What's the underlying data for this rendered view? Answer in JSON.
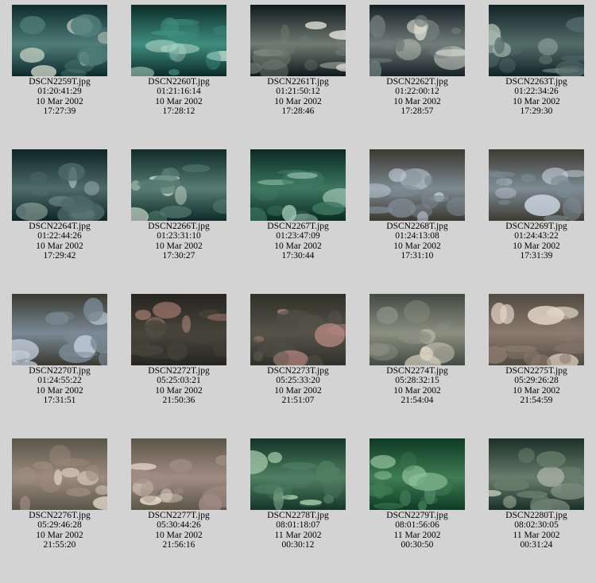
{
  "thumbnails": [
    {
      "file": "DSCN2259T.jpg",
      "timecode": "01:20:41:29",
      "date": "10 Mar 2002",
      "time": "17:27:39",
      "colors": [
        "#0d2a2d",
        "#4f7d79",
        "#c9d2c4"
      ]
    },
    {
      "file": "DSCN2260T.jpg",
      "timecode": "01:21:16:14",
      "date": "10 Mar 2002",
      "time": "17:28:12",
      "colors": [
        "#0b2b28",
        "#3f8d7f",
        "#b9dccb"
      ]
    },
    {
      "file": "DSCN2261T.jpg",
      "timecode": "01:21:50:12",
      "date": "10 Mar 2002",
      "time": "17:28:46",
      "colors": [
        "#10191b",
        "#6f7a73",
        "#e2e0d6"
      ]
    },
    {
      "file": "DSCN2262T.jpg",
      "timecode": "01:22:00:12",
      "date": "10 Mar 2002",
      "time": "17:28:57",
      "colors": [
        "#142024",
        "#707d79",
        "#dcdcd2"
      ]
    },
    {
      "file": "DSCN2263T.jpg",
      "timecode": "01:22:34:26",
      "date": "10 Mar 2002",
      "time": "17:29:30",
      "colors": [
        "#102326",
        "#556d69",
        "#aebfb6"
      ]
    },
    {
      "file": "DSCN2264T.jpg",
      "timecode": "01:22:44:26",
      "date": "10 Mar 2002",
      "time": "17:29:42",
      "colors": [
        "#0e2326",
        "#4d6b68",
        "#a8bdb5"
      ]
    },
    {
      "file": "DSCN2266T.jpg",
      "timecode": "01:23:31:10",
      "date": "10 Mar 2002",
      "time": "17:30:27",
      "colors": [
        "#0f2a27",
        "#577d73",
        "#c8d5c8"
      ]
    },
    {
      "file": "DSCN2267T.jpg",
      "timecode": "01:23:47:09",
      "date": "10 Mar 2002",
      "time": "17:30:44",
      "colors": [
        "#0b2a22",
        "#3d7762",
        "#a3cab7"
      ]
    },
    {
      "file": "DSCN2268T.jpg",
      "timecode": "01:24:13:08",
      "date": "10 Mar 2002",
      "time": "17:31:10",
      "colors": [
        "#3b3830",
        "#7d8a92",
        "#c8d3e0"
      ]
    },
    {
      "file": "DSCN2269T.jpg",
      "timecode": "01:24:43:22",
      "date": "10 Mar 2002",
      "time": "17:31:39",
      "colors": [
        "#3d3a31",
        "#7d8b93",
        "#cbd6e2"
      ]
    },
    {
      "file": "DSCN2270T.jpg",
      "timecode": "01:24:55:22",
      "date": "10 Mar 2002",
      "time": "17:31:51",
      "colors": [
        "#3a3931",
        "#7a8994",
        "#c9d4e1"
      ]
    },
    {
      "file": "DSCN2272T.jpg",
      "timecode": "05:25:03:21",
      "date": "10 Mar 2002",
      "time": "21:50:36",
      "colors": [
        "#262520",
        "#47453b",
        "#b28377"
      ]
    },
    {
      "file": "DSCN2273T.jpg",
      "timecode": "05:25:33:20",
      "date": "10 Mar 2002",
      "time": "21:51:07",
      "colors": [
        "#30302a",
        "#555349",
        "#b88a80"
      ]
    },
    {
      "file": "DSCN2274T.jpg",
      "timecode": "05:28:32:15",
      "date": "10 Mar 2002",
      "time": "21:54:04",
      "colors": [
        "#434a44",
        "#8c8f80",
        "#d6cfc0"
      ]
    },
    {
      "file": "DSCN2275T.jpg",
      "timecode": "05:29:26:28",
      "date": "10 Mar 2002",
      "time": "21:54:59",
      "colors": [
        "#4f4b41",
        "#8b7a6f",
        "#e3d6c8"
      ]
    },
    {
      "file": "DSCN2276T.jpg",
      "timecode": "05:29:46:28",
      "date": "10 Mar 2002",
      "time": "21:55:20",
      "colors": [
        "#5a5649",
        "#9d8a80",
        "#e8dccf"
      ]
    },
    {
      "file": "DSCN2277T.jpg",
      "timecode": "05:30:44:26",
      "date": "10 Mar 2002",
      "time": "21:56:16",
      "colors": [
        "#5c5649",
        "#a08c84",
        "#eee2d4"
      ]
    },
    {
      "file": "DSCN2278T.jpg",
      "timecode": "08:01:18:07",
      "date": "11 Mar 2002",
      "time": "00:30:12",
      "colors": [
        "#123527",
        "#4f7f62",
        "#a7c9aa"
      ]
    },
    {
      "file": "DSCN2279T.jpg",
      "timecode": "08:01:56:06",
      "date": "11 Mar 2002",
      "time": "00:30:50",
      "colors": [
        "#0f3a24",
        "#3f7d55",
        "#94c59d"
      ]
    },
    {
      "file": "DSCN2280T.jpg",
      "timecode": "08:02:30:05",
      "date": "11 Mar 2002",
      "time": "00:31:24",
      "colors": [
        "#1a3028",
        "#6a7d6c",
        "#c3c8b8"
      ]
    }
  ]
}
